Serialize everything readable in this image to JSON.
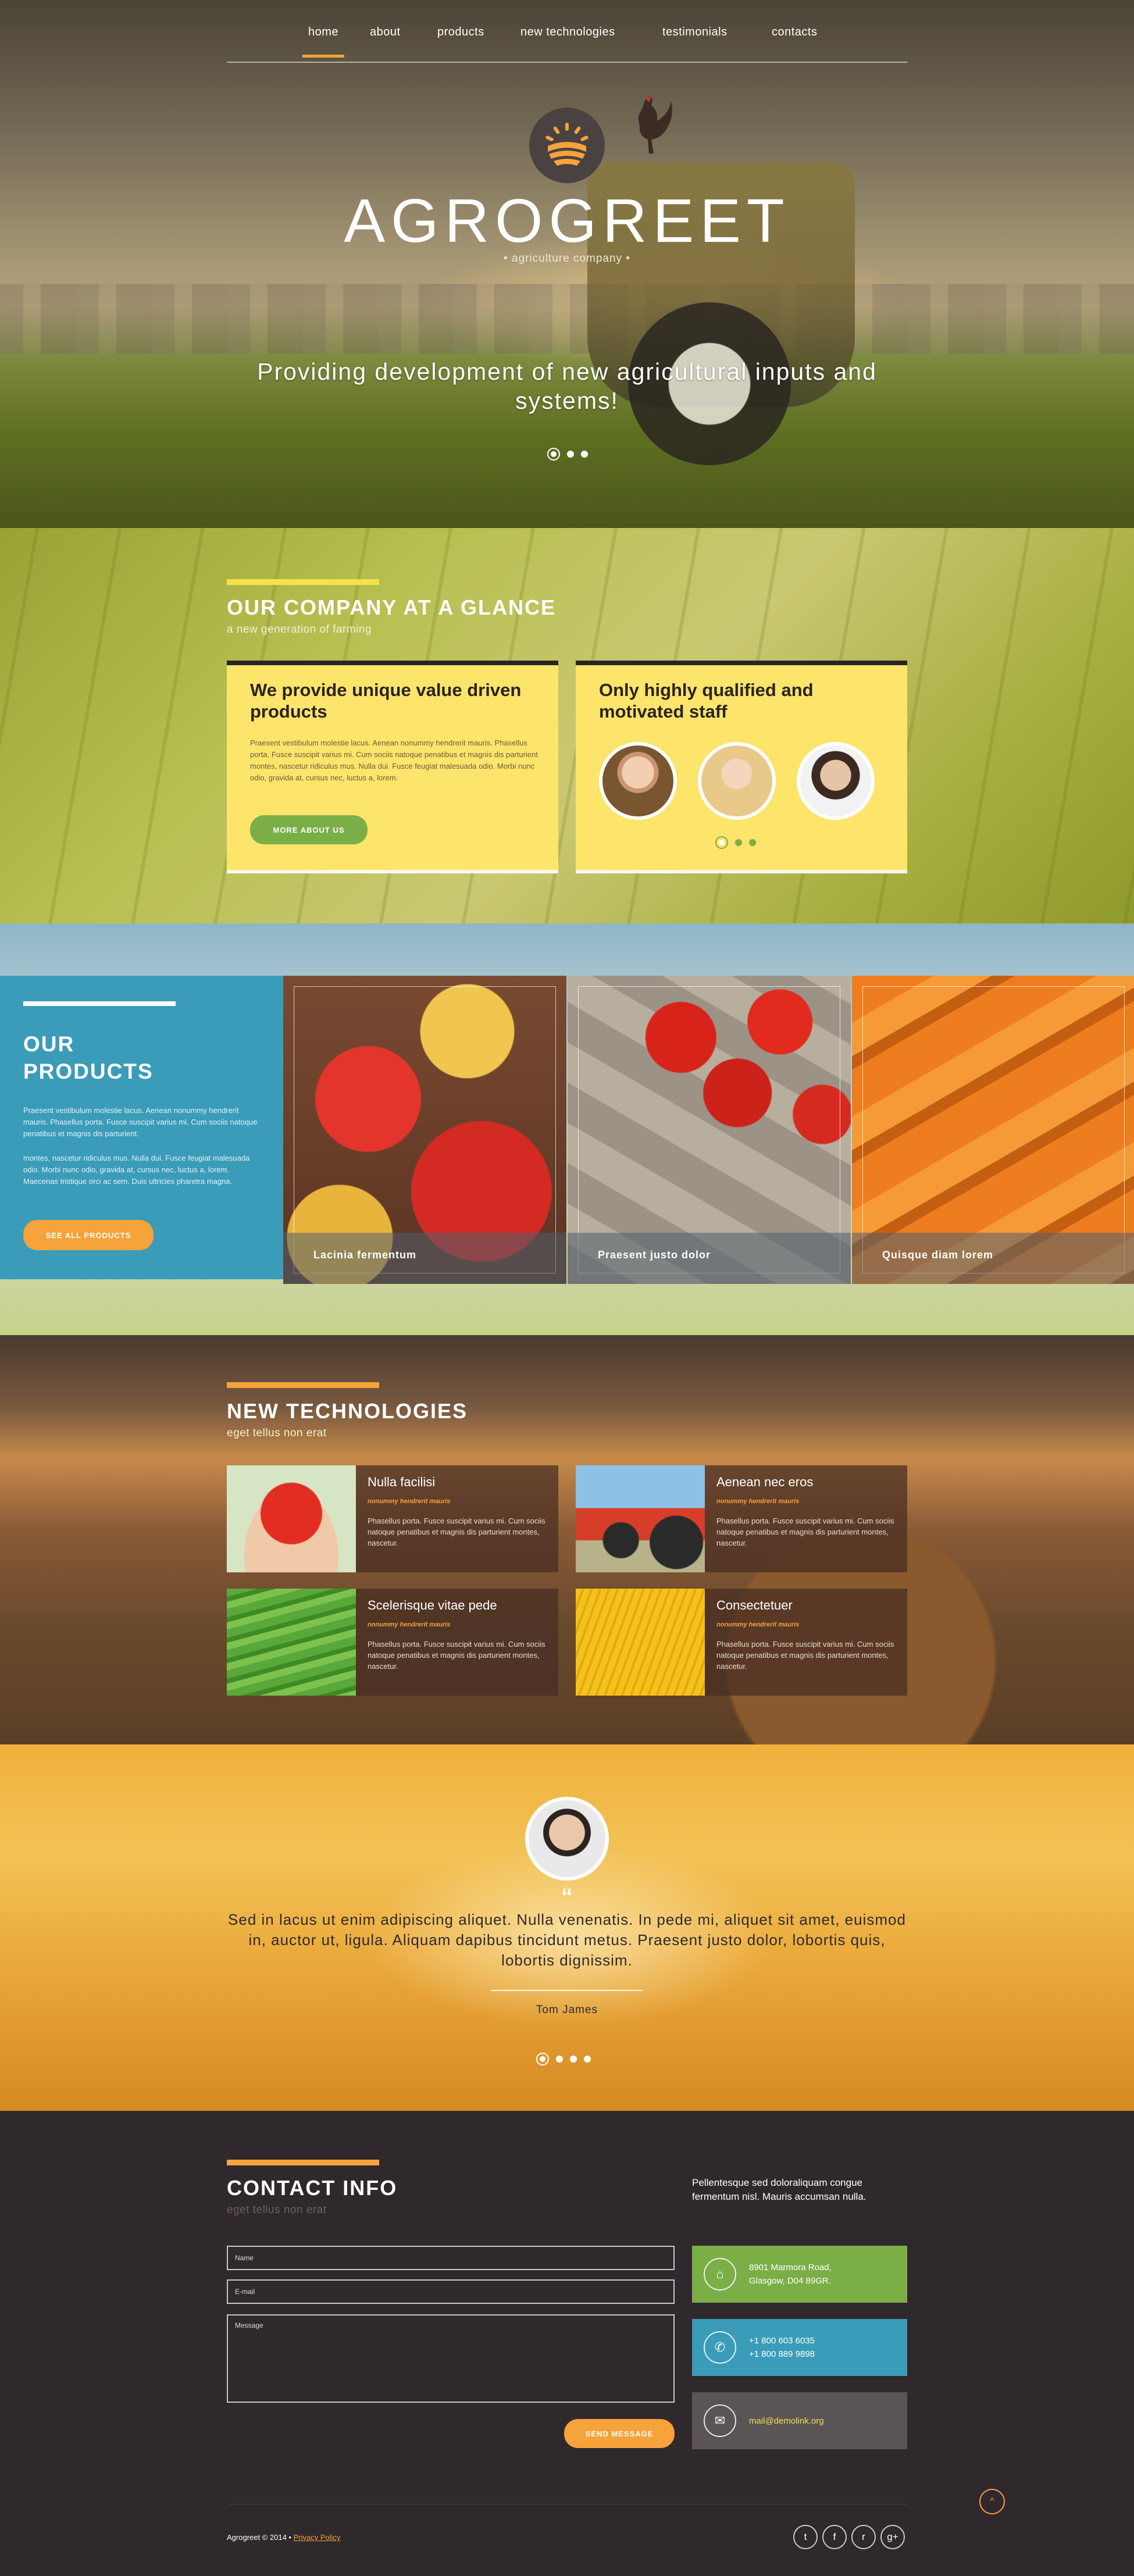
{
  "nav": {
    "items": [
      {
        "label": "home",
        "active": true
      },
      {
        "label": "about"
      },
      {
        "label": "products"
      },
      {
        "label": "new technologies"
      },
      {
        "label": "testimonials"
      },
      {
        "label": "contacts"
      }
    ]
  },
  "hero": {
    "brand": "AGROGREET",
    "subtitle": "• agriculture company •",
    "tagline": "Providing development of new agricultural inputs and systems!",
    "slides": 3,
    "active_slide": 1
  },
  "company": {
    "title": "OUR COMPANY AT A GLANCE",
    "subtitle": "a new generation of farming",
    "card1": {
      "title": "We provide unique value driven products",
      "body": "Praesent vestibulum molestie lacus. Aenean nonummy hendrerit mauris. Phasellus porta. Fusce suscipit varius mi. Cum sociis natoque penatibus et magnis dis parturient montes, nascetur ridiculus mus. Nulla dui. Fusce feugiat malesuada odio. Morbi nunc odio, gravida at, cursus nec, luctus a, lorem.",
      "button": "MORE ABOUT US"
    },
    "card2": {
      "title": "Only highly qualified and motivated staff",
      "staff_slides": 3,
      "active_slide": 1
    }
  },
  "products": {
    "title_line1": "OUR",
    "title_line2": "PRODUCTS",
    "body1": "Praesent vestibulum molestie lacus. Aenean nonummy hendrerit mauris. Phasellus porta. Fusce suscipit varius mi. Cum sociis natoque penatibus et magnis dis parturient.",
    "body2": "montes, nascetur ridiculus mus. Nulla dui. Fusce feugiat malesuada odio. Morbi nunc odio, gravida at, cursus nec, luctus a, lorem. Maecenas tristique orci ac sem. Duis ultricies pharetra magna.",
    "button": "SEE ALL PRODUCTS",
    "tiles": [
      {
        "caption": "Lacinia fermentum"
      },
      {
        "caption": "Praesent justo dolor"
      },
      {
        "caption": "Quisque diam lorem"
      }
    ]
  },
  "tech": {
    "title": "NEW TECHNOLOGIES",
    "subtitle": "eget tellus non erat",
    "items": [
      {
        "title": "Nulla facilisi",
        "meta": "nonummy hendrerit mauris",
        "text": "Phasellus porta. Fusce suscipit varius mi. Cum sociis natoque penatibus et magnis dis parturient montes, nascetur."
      },
      {
        "title": "Aenean nec eros",
        "meta": "nonummy hendrerit mauris",
        "text": "Phasellus porta. Fusce suscipit varius mi. Cum sociis natoque penatibus et magnis dis parturient montes, nascetur."
      },
      {
        "title": "Scelerisque vitae pede",
        "meta": "nonummy hendrerit mauris",
        "text": "Phasellus porta. Fusce suscipit varius mi. Cum sociis natoque penatibus et magnis dis parturient montes, nascetur."
      },
      {
        "title": "Consectetuer",
        "meta": "nonummy hendrerit mauris",
        "text": "Phasellus porta. Fusce suscipit varius mi. Cum sociis natoque penatibus et magnis dis parturient montes, nascetur."
      }
    ]
  },
  "testimonial": {
    "quote_mark": "“",
    "quote": "Sed in lacus ut enim adipiscing aliquet. Nulla venenatis. In pede mi, aliquet sit amet, euismod in, auctor ut, ligula. Aliquam dapibus tincidunt metus. Praesent justo dolor, lobortis quis, lobortis dignissim.",
    "author": "Tom James",
    "slides": 4,
    "active_slide": 1
  },
  "contact": {
    "title": "CONTACT INFO",
    "subtitle": "eget tellus non erat",
    "intro": "Pellentesque sed doloraliquam congue fermentum nisl. Mauris accumsan nulla.",
    "form": {
      "name_placeholder": "Name",
      "email_placeholder": "E-mail",
      "message_placeholder": "Message",
      "send_label": "SEND MESSAGE"
    },
    "address": "8901 Marmora Road, Glasgow, D04 89GR.",
    "phone1": "+1 800 603 6035",
    "phone2": "+1 800 889 9898",
    "email": "mail@demolink.org",
    "colors": {
      "address_box": "#7cae47",
      "phone_box": "#3a9cb8",
      "email_box": "#5a5457",
      "accent": "#f5a33a"
    }
  },
  "footer": {
    "copyright": "Agrogreet © 2014 •",
    "privacy": "Privacy Policy",
    "social": [
      {
        "icon": "twitter-icon",
        "glyph": "t"
      },
      {
        "icon": "facebook-icon",
        "glyph": "f"
      },
      {
        "icon": "rss-icon",
        "glyph": "r"
      },
      {
        "icon": "google-plus-icon",
        "glyph": "g+"
      }
    ]
  }
}
